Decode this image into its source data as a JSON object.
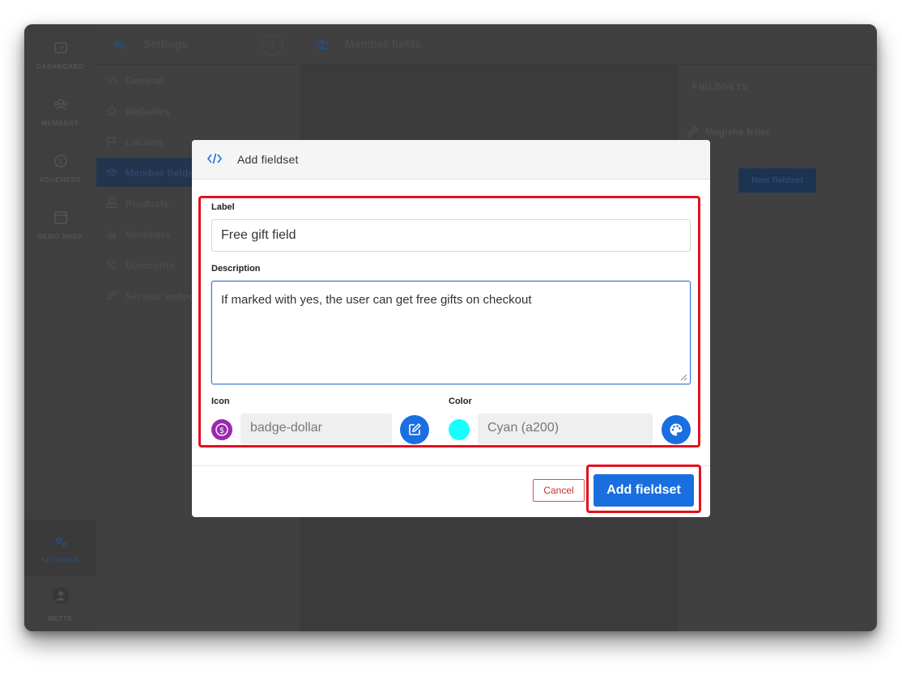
{
  "rail": {
    "items": [
      {
        "label": "DASHBOARD",
        "icon": "dashboard-icon"
      },
      {
        "label": "MEMBERS",
        "icon": "members-icon"
      },
      {
        "label": "VOUCHERS",
        "icon": "voucher-icon"
      },
      {
        "label": "DEMO SHOP",
        "icon": "shop-icon"
      }
    ],
    "settings_label": "SETTINGS",
    "user_label": "METTE"
  },
  "sidebar": {
    "title": "Settings",
    "collapse_glyph": "‹",
    "items": [
      {
        "label": "General",
        "icon": "code-icon"
      },
      {
        "label": "Websites",
        "icon": "home-icon"
      },
      {
        "label": "Locales",
        "icon": "flag-icon"
      },
      {
        "label": "Member fields",
        "icon": "members-icon",
        "active": true
      },
      {
        "label": "Products",
        "icon": "boxes-icon"
      },
      {
        "label": "Vouchers",
        "icon": "stamp-icon"
      },
      {
        "label": "Discounts",
        "icon": "percent-icon"
      },
      {
        "label": "Service endpoints",
        "icon": "link-icon"
      }
    ]
  },
  "main": {
    "title": "Member fields"
  },
  "fieldsets_panel": {
    "header": "FIELDSETS",
    "items": [
      "Magiske felter"
    ],
    "new_button": "New fieldset"
  },
  "modal": {
    "title": "Add fieldset",
    "label_caption": "Label",
    "label_value": "Free gift field",
    "description_caption": "Description",
    "description_value": "If marked with yes, the user can get free gifts on checkout",
    "icon_caption": "Icon",
    "icon_value": "badge-dollar",
    "icon_color": "#9c27b0",
    "color_caption": "Color",
    "color_value": "Cyan (a200)",
    "color_swatch": "#18ffff",
    "cancel_label": "Cancel",
    "submit_label": "Add fieldset"
  },
  "colors": {
    "accent": "#1a6fe0",
    "highlight": "#e3101e"
  }
}
